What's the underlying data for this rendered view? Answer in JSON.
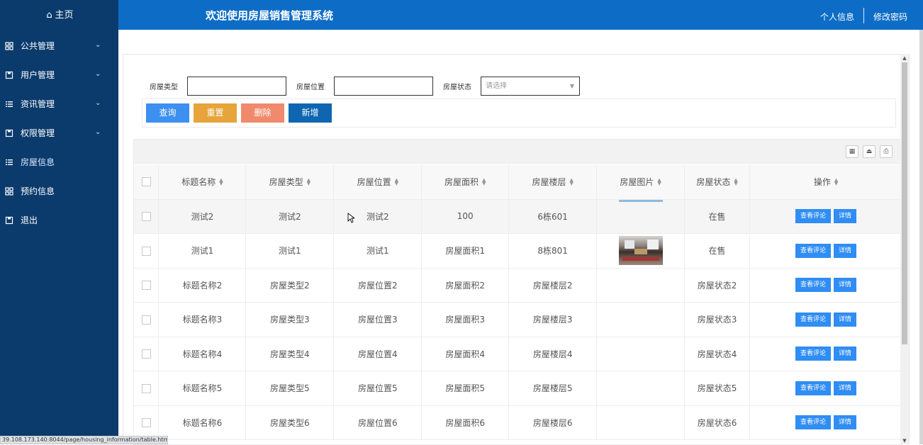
{
  "sidebar": {
    "home": "主页",
    "items": [
      {
        "label": "公共管理",
        "icon": "grid-icon",
        "has_submenu": true
      },
      {
        "label": "用户管理",
        "icon": "save-icon",
        "has_submenu": true
      },
      {
        "label": "资讯管理",
        "icon": "list-icon",
        "has_submenu": true
      },
      {
        "label": "权限管理",
        "icon": "save-icon",
        "has_submenu": true
      },
      {
        "label": "房屋信息",
        "icon": "list-icon",
        "has_submenu": false,
        "active": true
      },
      {
        "label": "预约信息",
        "icon": "grid-icon",
        "has_submenu": false
      },
      {
        "label": "退出",
        "icon": "save-icon",
        "has_submenu": false
      }
    ]
  },
  "header": {
    "title": "欢迎使用房屋销售管理系统",
    "profile_link": "个人信息",
    "password_link": "修改密码"
  },
  "search": {
    "type_label": "房屋类型",
    "type_value": "",
    "location_label": "房屋位置",
    "location_value": "",
    "status_label": "房屋状态",
    "status_placeholder": "请选择"
  },
  "buttons": {
    "query": "查询",
    "reset": "重置",
    "delete": "删除",
    "add": "新增"
  },
  "colors": {
    "sidebar_bg": "#0b3b6d",
    "header_bg": "#0d6dc6",
    "query_btn": "#3d8ff0",
    "reset_btn": "#e6a43b",
    "delete_btn": "#f08a6c",
    "add_btn": "#0f66b0",
    "op_btn": "#2f8df3"
  },
  "table": {
    "columns": [
      "标题名称",
      "房屋类型",
      "房屋位置",
      "房屋面积",
      "房屋楼层",
      "房屋图片",
      "房屋状态",
      "操作"
    ],
    "rows": [
      {
        "title": "测试2",
        "type": "测试2",
        "location": "测试2",
        "area": "100",
        "floor": "6栋601",
        "image": "strip",
        "status": "在售"
      },
      {
        "title": "测试1",
        "type": "测试1",
        "location": "测试1",
        "area": "房屋面积1",
        "floor": "8栋801",
        "image": "photo",
        "status": "在售"
      },
      {
        "title": "标题名称2",
        "type": "房屋类型2",
        "location": "房屋位置2",
        "area": "房屋面积2",
        "floor": "房屋楼层2",
        "image": "",
        "status": "房屋状态2"
      },
      {
        "title": "标题名称3",
        "type": "房屋类型3",
        "location": "房屋位置3",
        "area": "房屋面积3",
        "floor": "房屋楼层3",
        "image": "",
        "status": "房屋状态3"
      },
      {
        "title": "标题名称4",
        "type": "房屋类型4",
        "location": "房屋位置4",
        "area": "房屋面积4",
        "floor": "房屋楼层4",
        "image": "",
        "status": "房屋状态4"
      },
      {
        "title": "标题名称5",
        "type": "房屋类型5",
        "location": "房屋位置5",
        "area": "房屋面积5",
        "floor": "房屋楼层5",
        "image": "",
        "status": "房屋状态5"
      },
      {
        "title": "标题名称6",
        "type": "房屋类型6",
        "location": "房屋位置6",
        "area": "房屋面积6",
        "floor": "房屋楼层6",
        "image": "",
        "status": "房屋状态6"
      }
    ],
    "op_view_comments": "查看评论",
    "op_detail": "详情"
  },
  "status_bar": "39.108.173.140:8044/page/housing_information/table.html"
}
